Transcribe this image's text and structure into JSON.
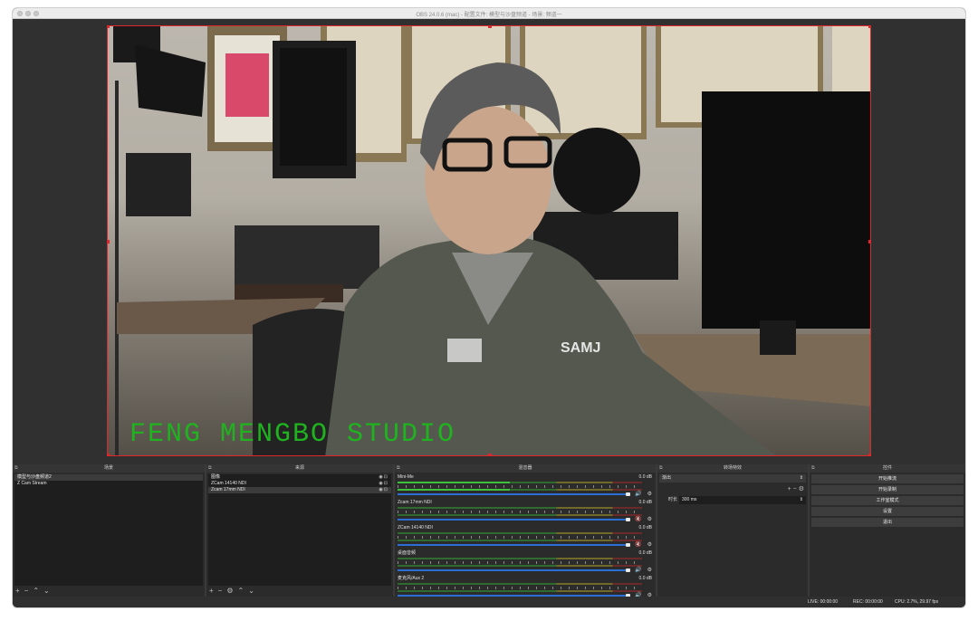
{
  "window": {
    "title": "OBS 24.0.6 (mac) - 配置文件: 模型与沙盘频道 - 场景: 频道一"
  },
  "preview": {
    "overlay_text": "FENG MENGBO STUDIO",
    "overlay_color": "#1fb31f",
    "border_color": "#e0262a"
  },
  "scenes": {
    "title": "场景",
    "items": [
      {
        "label": "模型与沙盘频道2",
        "selected": true
      },
      {
        "label": "Z Cam Stream",
        "selected": false
      }
    ]
  },
  "sources": {
    "title": "来源",
    "items": [
      {
        "label": "图像",
        "selected": false
      },
      {
        "label": "ZCam 14140 NDI",
        "selected": false
      },
      {
        "label": "Zcam 17mm NDI",
        "selected": true
      }
    ]
  },
  "mixer": {
    "title": "混音器",
    "tracks": [
      {
        "name": "Mini-Me",
        "db": "0.0 dB",
        "level": 0.46,
        "muted": false
      },
      {
        "name": "Zcam 17mm NDI",
        "db": "0.0 dB",
        "level": 0.0,
        "muted": true
      },
      {
        "name": "ZCam 14140 NDI",
        "db": "0.0 dB",
        "level": 0.0,
        "muted": true
      },
      {
        "name": "桌面音频",
        "db": "0.0 dB",
        "level": 0.0,
        "muted": false
      },
      {
        "name": "麦克风/Aux 2",
        "db": "0.0 dB",
        "level": 0.0,
        "muted": false
      }
    ]
  },
  "transitions": {
    "title": "转场特效",
    "selected": "渐出",
    "duration_label": "时长",
    "duration_value": "300 ms"
  },
  "controls": {
    "title": "控件",
    "start_streaming": "开始推流",
    "start_recording": "开始录制",
    "studio_mode": "工作室模式",
    "settings": "设置",
    "exit": "退出"
  },
  "status": {
    "live": "LIVE: 00:00:00",
    "rec": "REC: 00:00:00",
    "cpu": "CPU: 2.7%, 29.97 fps"
  },
  "colors": {
    "accent_blue": "#2a6fd6",
    "meter_green": "#3ec23e",
    "mute_red": "#d33a3a"
  }
}
